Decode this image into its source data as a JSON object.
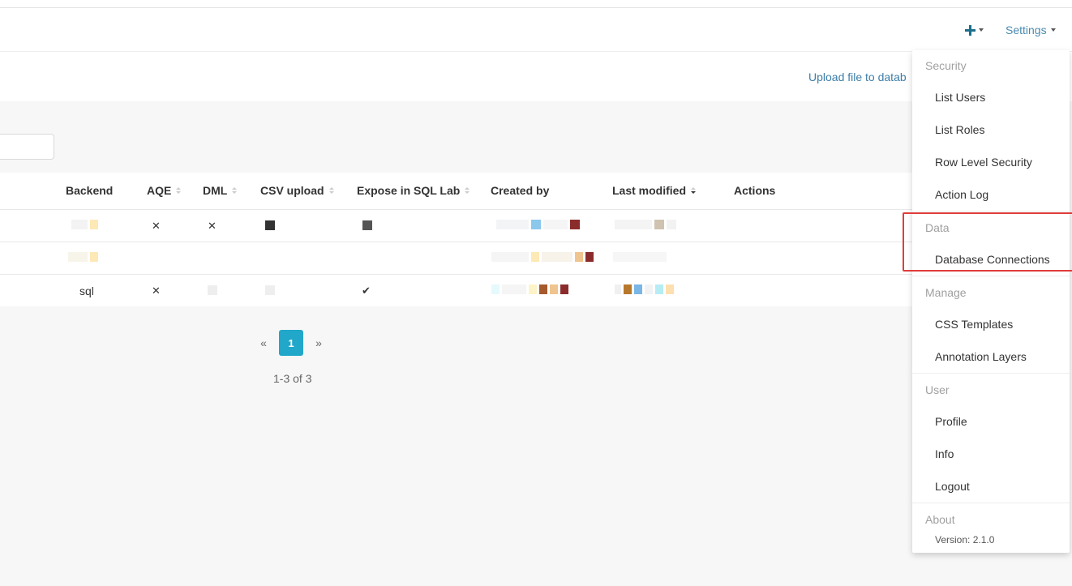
{
  "navbar": {
    "plus_menu": "+",
    "settings_label": "Settings"
  },
  "subheader": {
    "upload_link": "Upload file to datab"
  },
  "table": {
    "columns": [
      "Backend",
      "AQE",
      "DML",
      "CSV upload",
      "Expose in SQL Lab",
      "Created by",
      "Last modified",
      "Actions"
    ],
    "rows": [
      {
        "backend": "",
        "aqe": "✕",
        "dml": "✕",
        "csv_upload": "",
        "expose_sql_lab": ""
      },
      {
        "backend": "",
        "aqe": "",
        "dml": "",
        "csv_upload": "",
        "expose_sql_lab": ""
      },
      {
        "backend": "sql",
        "aqe": "✕",
        "dml": "",
        "csv_upload": "",
        "expose_sql_lab": "✔"
      }
    ]
  },
  "pagination": {
    "prev": "«",
    "page": "1",
    "next": "»",
    "count": "1-3 of 3"
  },
  "settings_menu": {
    "security_header": "Security",
    "security_items": [
      "List Users",
      "List Roles",
      "Row Level Security",
      "Action Log"
    ],
    "data_header": "Data",
    "data_items": [
      "Database Connections"
    ],
    "manage_header": "Manage",
    "manage_items": [
      "CSS Templates",
      "Annotation Layers"
    ],
    "user_header": "User",
    "user_items": [
      "Profile",
      "Info",
      "Logout"
    ],
    "about_header": "About",
    "version": "Version: 2.1.0"
  },
  "colors": {
    "accent": "#20a7c9",
    "link": "#3e7ea8",
    "highlight": "#e03c3c"
  }
}
